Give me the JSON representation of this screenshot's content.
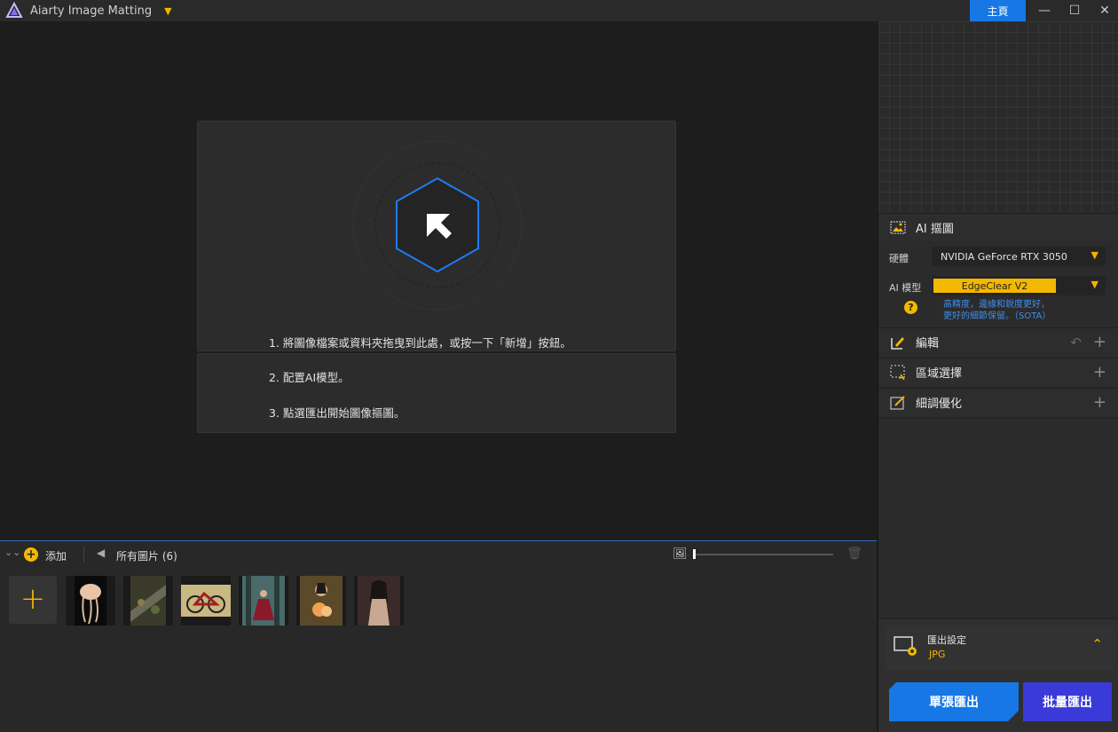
{
  "app": {
    "title": "Aiarty Image Matting",
    "home_label": "主頁"
  },
  "window": {
    "minimize": "—",
    "maximize": "☐",
    "close": "✕"
  },
  "dropzone": {
    "step1": "1. 將圖像檔案或資料夾拖曳到此處，或按一下「新增」按鈕。",
    "step2": "2. 配置AI模型。",
    "step3": "3. 點選匯出開始圖像摳圖。"
  },
  "strip": {
    "add_label": "添加",
    "all_images_label": "所有圖片 (6)",
    "thumbnails": [
      "jellyfish",
      "mossy-log",
      "bicycle",
      "woman-red-dress-forest",
      "woman-bouquet",
      "woman-floral-dress"
    ]
  },
  "panel": {
    "ai_matting": {
      "title": "AI 摳圖",
      "hardware_label": "硬體",
      "hardware_value": "NVIDIA GeForce RTX 3050",
      "model_label": "AI 模型",
      "model_value": "EdgeClear  V2",
      "desc_line1": "高精度，邊緣和銳度更好，",
      "desc_line2": "更好的細節保留。（SOTA）"
    },
    "edit": {
      "title": "編輯"
    },
    "region": {
      "title": "區域選擇"
    },
    "refine": {
      "title": "細調優化"
    },
    "export": {
      "title": "匯出設定",
      "format": "JPG"
    },
    "buttons": {
      "single": "單張匯出",
      "batch": "批量匯出"
    }
  },
  "colors": {
    "accent_yellow": "#f5b800",
    "accent_blue": "#1677e5",
    "batch_purple": "#3a3ad8"
  }
}
